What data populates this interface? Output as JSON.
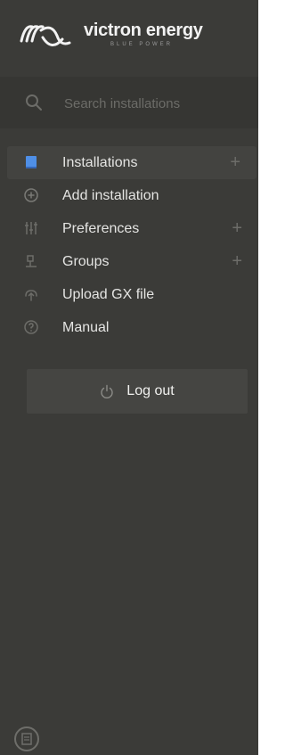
{
  "brand": {
    "name": "victron energy",
    "tagline": "BLUE POWER"
  },
  "search": {
    "placeholder": "Search installations"
  },
  "menu": {
    "items": [
      {
        "label": "Installations",
        "icon": "installations-icon",
        "has_plus": true
      },
      {
        "label": "Add installation",
        "icon": "add-circle-icon",
        "has_plus": false
      },
      {
        "label": "Preferences",
        "icon": "sliders-icon",
        "has_plus": true
      },
      {
        "label": "Groups",
        "icon": "groups-icon",
        "has_plus": true
      },
      {
        "label": "Upload GX file",
        "icon": "upload-icon",
        "has_plus": false
      },
      {
        "label": "Manual",
        "icon": "help-circle-icon",
        "has_plus": false
      }
    ],
    "plus_symbol": "+"
  },
  "logout": {
    "label": "Log out"
  },
  "colors": {
    "sidebar_bg": "#3b3b38",
    "accent_blue": "#4f8fe6",
    "text": "#e4e4e2"
  }
}
